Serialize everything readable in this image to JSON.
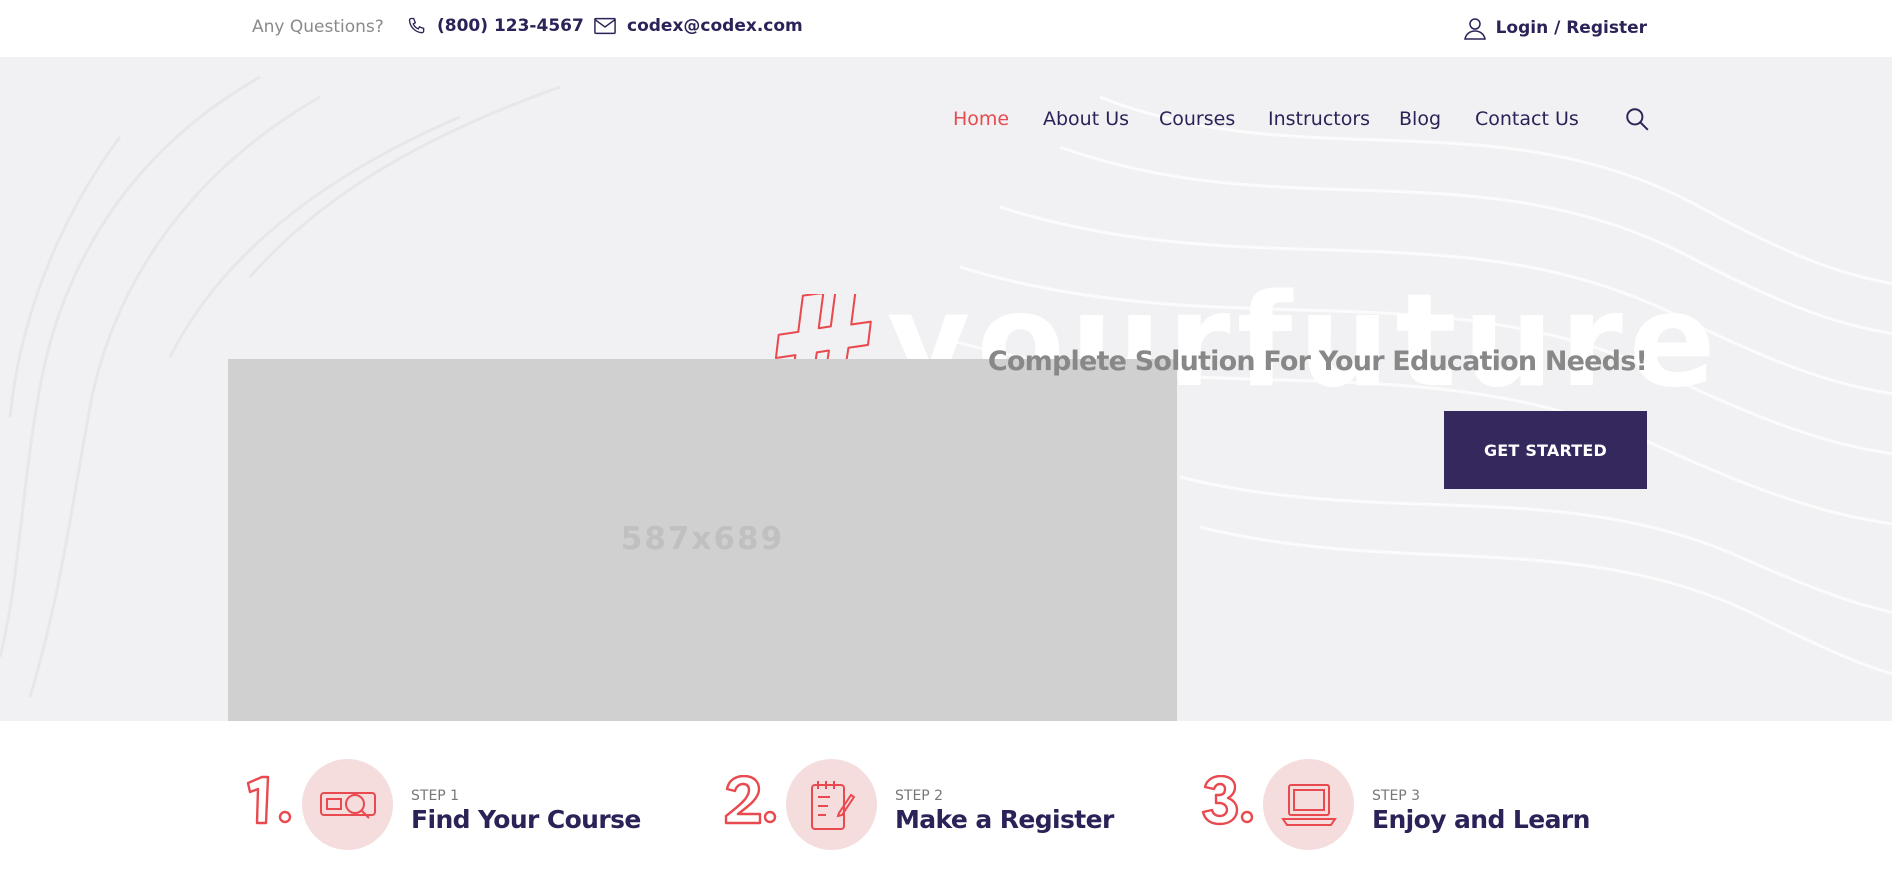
{
  "topbar": {
    "question": "Any Questions?",
    "phone": "(800) 123-4567",
    "email": "codex@codex.com",
    "login": "Login / Register"
  },
  "nav": {
    "items": [
      "Home",
      "About Us",
      "Courses",
      "Instructors",
      "Blog",
      "Contact Us"
    ],
    "active": "Home"
  },
  "hero": {
    "hashtag_symbol": "#",
    "hashtag_word": "yourfuture",
    "subtitle": "Complete Solution For Your Education Needs!",
    "cta": "GET STARTED",
    "image_placeholder": "587x689"
  },
  "steps": [
    {
      "number": "1.",
      "label": "STEP 1",
      "title": "Find Your Course",
      "icon": "search-course-icon"
    },
    {
      "number": "2.",
      "label": "STEP 2",
      "title": "Make a Register",
      "icon": "clipboard-icon"
    },
    {
      "number": "3.",
      "label": "STEP 3",
      "title": "Enjoy and Learn",
      "icon": "laptop-icon"
    }
  ],
  "colors": {
    "accent": "#e84a4f",
    "navy": "#2b2358",
    "button": "#35285d",
    "hero_bg": "#f1f1f3",
    "step_circle": "#f5dcdd"
  }
}
